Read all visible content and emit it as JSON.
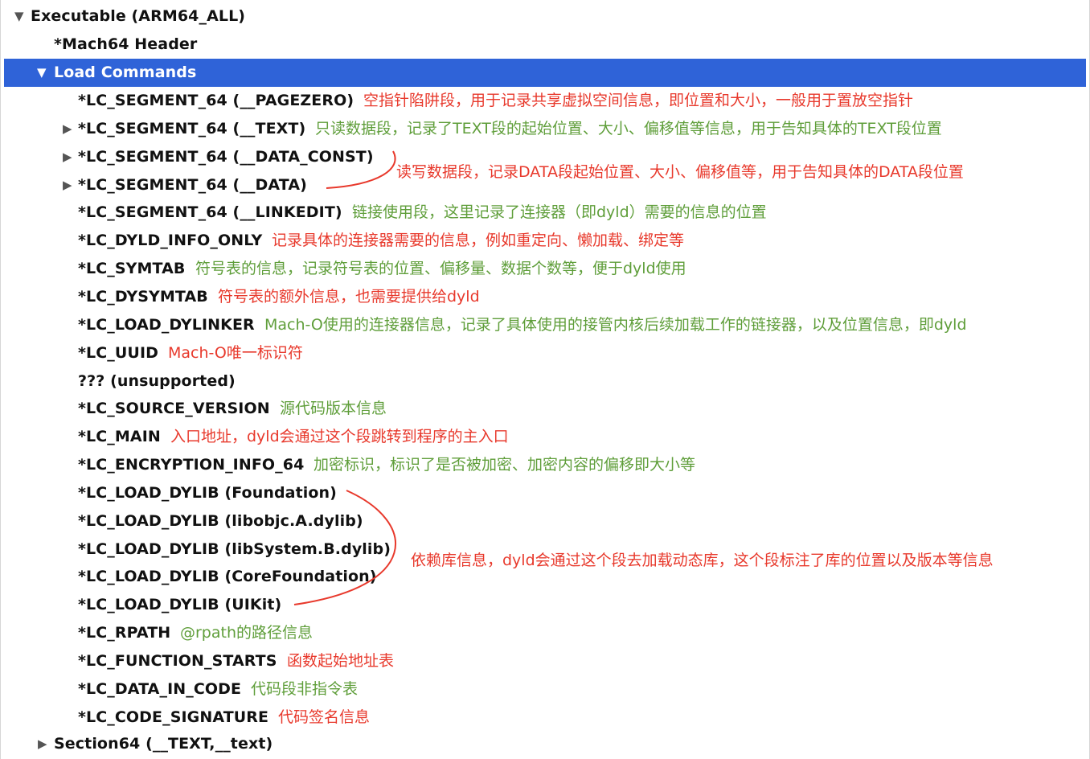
{
  "colors": {
    "selection": "#2f63d8",
    "annotation_red": "#e8392c",
    "annotation_green": "#5f9e3a",
    "text": "#111111"
  },
  "tree": {
    "root_label": "Executable  (ARM64_ALL)",
    "mach_header": "*Mach64 Header",
    "load_commands_label": "Load Commands",
    "section_label": "Section64 (__TEXT,__text)",
    "commands": [
      {
        "label": "*LC_SEGMENT_64 (__PAGEZERO)",
        "note": "空指针陷阱段，用于记录共享虚拟空间信息，即位置和大小，一般用于置放空指针",
        "note_color": "red"
      },
      {
        "label": "*LC_SEGMENT_64 (__TEXT)",
        "note": "只读数据段，记录了TEXT段的起始位置、大小、偏移值等信息，用于告知具体的TEXT段位置",
        "note_color": "green"
      },
      {
        "label": "*LC_SEGMENT_64 (__DATA_CONST)",
        "note": "",
        "note_color": ""
      },
      {
        "label": "*LC_SEGMENT_64 (__DATA)",
        "note": "",
        "note_color": ""
      },
      {
        "label": "*LC_SEGMENT_64 (__LINKEDIT)",
        "note": "链接使用段，这里记录了连接器（即dyld）需要的信息的位置",
        "note_color": "green"
      },
      {
        "label": "*LC_DYLD_INFO_ONLY",
        "note": "记录具体的连接器需要的信息，例如重定向、懒加载、绑定等",
        "note_color": "red"
      },
      {
        "label": "*LC_SYMTAB",
        "note": "符号表的信息，记录符号表的位置、偏移量、数据个数等，便于dyld使用",
        "note_color": "green"
      },
      {
        "label": "*LC_DYSYMTAB",
        "note": "符号表的额外信息，也需要提供给dyld",
        "note_color": "red"
      },
      {
        "label": "*LC_LOAD_DYLINKER",
        "note": "Mach-O使用的连接器信息，记录了具体使用的接管内核后续加载工作的链接器，以及位置信息，即dyld",
        "note_color": "green"
      },
      {
        "label": "*LC_UUID",
        "note": "Mach-O唯一标识符",
        "note_color": "red"
      },
      {
        "label": "??? (unsupported)",
        "note": "",
        "note_color": ""
      },
      {
        "label": "*LC_SOURCE_VERSION",
        "note": "源代码版本信息",
        "note_color": "green"
      },
      {
        "label": "*LC_MAIN",
        "note": "入口地址，dyld会通过这个段跳转到程序的主入口",
        "note_color": "red"
      },
      {
        "label": "*LC_ENCRYPTION_INFO_64",
        "note": "加密标识，标识了是否被加密、加密内容的偏移即大小等",
        "note_color": "green"
      },
      {
        "label": "*LC_LOAD_DYLIB (Foundation)",
        "note": "",
        "note_color": ""
      },
      {
        "label": "*LC_LOAD_DYLIB (libobjc.A.dylib)",
        "note": "",
        "note_color": ""
      },
      {
        "label": "*LC_LOAD_DYLIB (libSystem.B.dylib)",
        "note": "",
        "note_color": ""
      },
      {
        "label": "*LC_LOAD_DYLIB (CoreFoundation)",
        "note": "",
        "note_color": ""
      },
      {
        "label": "*LC_LOAD_DYLIB (UIKit)",
        "note": "",
        "note_color": ""
      },
      {
        "label": "*LC_RPATH",
        "note": "@rpath的路径信息",
        "note_color": "green"
      },
      {
        "label": "*LC_FUNCTION_STARTS",
        "note": "函数起始地址表",
        "note_color": "red"
      },
      {
        "label": "*LC_DATA_IN_CODE",
        "note": "代码段非指令表",
        "note_color": "green"
      },
      {
        "label": "*LC_CODE_SIGNATURE",
        "note": "代码签名信息",
        "note_color": "red"
      }
    ]
  },
  "annotations": {
    "data_segments": "读写数据段，记录DATA段起始位置、大小、偏移值等，用于告知具体的DATA段位置",
    "dylibs": "依赖库信息，dyld会通过这个段去加载动态库，这个段标注了库的位置以及版本等信息"
  }
}
